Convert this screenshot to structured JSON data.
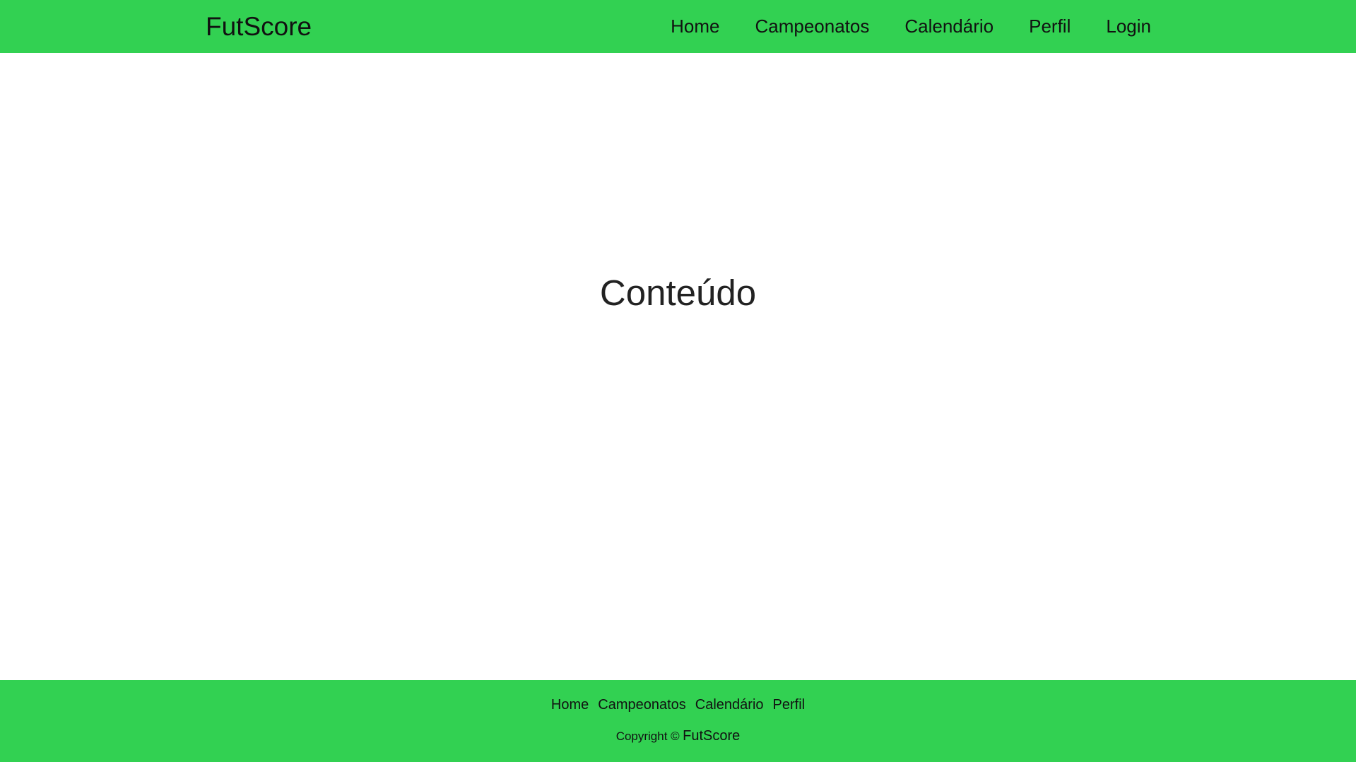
{
  "header": {
    "brand": "FutScore",
    "nav": [
      {
        "label": "Home"
      },
      {
        "label": "Campeonatos"
      },
      {
        "label": "Calendário"
      },
      {
        "label": "Perfil"
      },
      {
        "label": "Login"
      }
    ]
  },
  "main": {
    "title": "Conteúdo"
  },
  "footer": {
    "links": [
      {
        "label": "Home"
      },
      {
        "label": "Campeonatos"
      },
      {
        "label": "Calendário"
      },
      {
        "label": "Perfil"
      }
    ],
    "copyright_text": "Copyright ©",
    "copyright_brand": "FutScore"
  },
  "colors": {
    "brand_green": "#32d152",
    "text": "#111111"
  }
}
